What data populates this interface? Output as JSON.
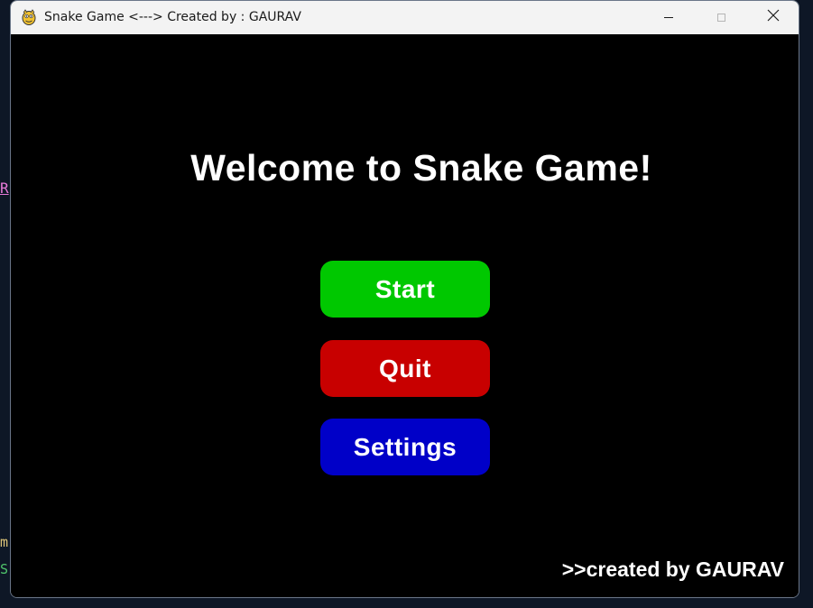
{
  "background_fragments": {
    "frag1": "R",
    "frag2": "m",
    "frag3": "S"
  },
  "window": {
    "title": "Snake Game <---> Created by : GAURAV",
    "icon": "pygame-snake-icon",
    "controls": {
      "minimize_icon": "minimize-icon",
      "maximize_icon": "maximize-icon",
      "close_icon": "close-icon"
    }
  },
  "game": {
    "welcome_text": "Welcome to Snake Game!",
    "buttons": [
      {
        "label": "Start",
        "color": "#00c800"
      },
      {
        "label": "Quit",
        "color": "#c80000"
      },
      {
        "label": "Settings",
        "color": "#0000c8"
      }
    ],
    "credit": ">>created by GAURAV"
  },
  "colors": {
    "canvas_bg": "#000000",
    "text": "#ffffff",
    "titlebar_bg": "#f3f3f3"
  }
}
